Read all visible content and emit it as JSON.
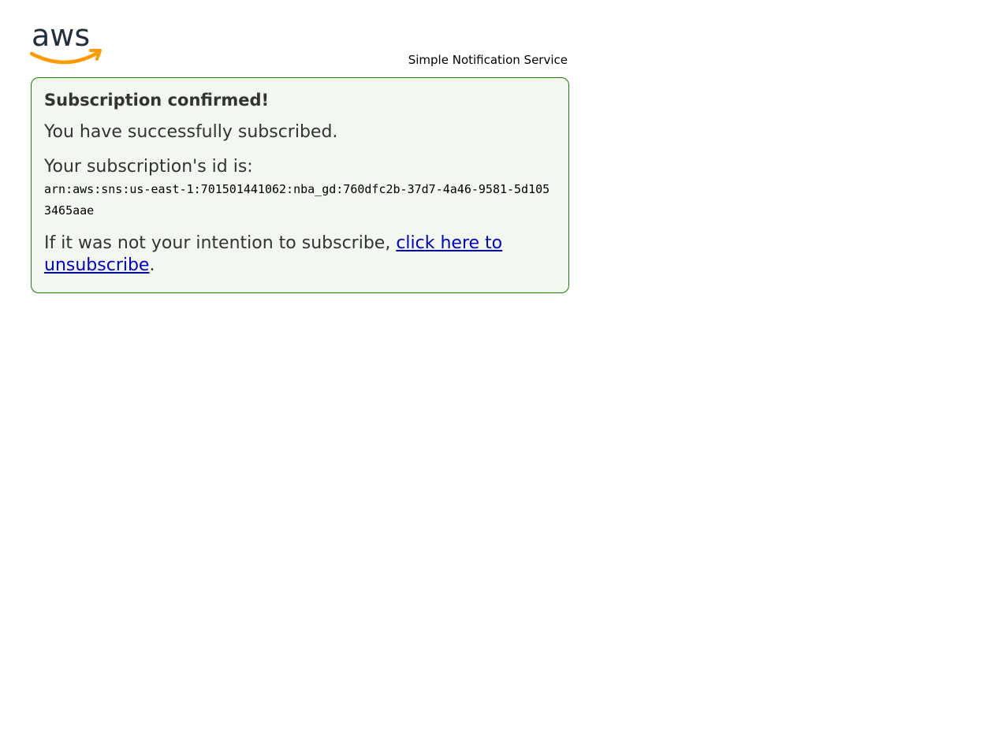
{
  "header": {
    "logo_text": "aws",
    "service_name": "Simple Notification Service"
  },
  "colors": {
    "logo_text": "#232f3e",
    "logo_smile": "#ff9900",
    "card_border": "#1d8102",
    "card_background": "#f2f7ef",
    "link": "#0000cc"
  },
  "card": {
    "title": "Subscription confirmed!",
    "message": "You have successfully subscribed.",
    "id_label": "Your subscription's id is:",
    "subscription_arn": "arn:aws:sns:us-east-1:701501441062:nba_gd:760dfc2b-37d7-4a46-9581-5d1053465aae",
    "unsubscribe_prefix": "If it was not your intention to subscribe, ",
    "unsubscribe_link": "click here to unsubscribe",
    "unsubscribe_suffix": "."
  }
}
